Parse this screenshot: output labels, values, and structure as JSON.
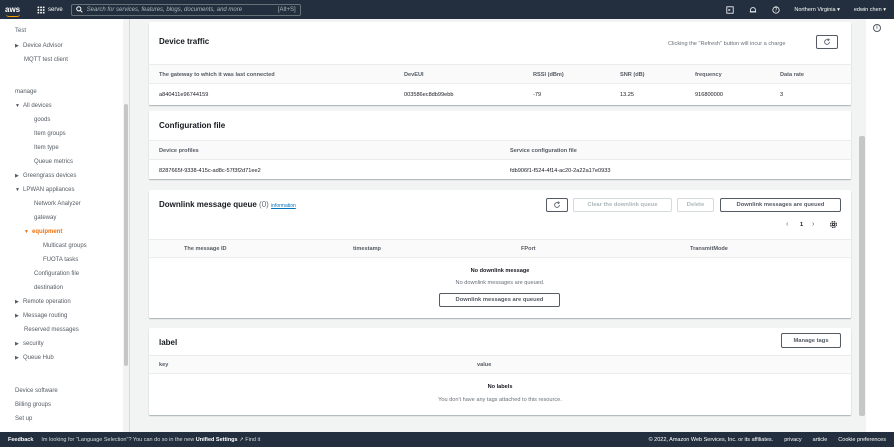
{
  "topbar": {
    "logo": "aws",
    "services_label": "serve",
    "search_placeholder": "Search for services, features, blogs, documents, and more",
    "search_shortcut": "[Alt+S]",
    "region": "Northern Virginia ▾",
    "user": "edwin chen ▾",
    "icons": [
      "grid-icon",
      "search-icon",
      "cloudshell-icon",
      "bell-icon",
      "help-icon"
    ]
  },
  "sidebar": {
    "items": [
      {
        "label": "Test",
        "type": "section"
      },
      {
        "label": "Device Advisor",
        "type": "collapsed"
      },
      {
        "label": "MQTT test client",
        "type": "item"
      },
      {
        "label": "manage",
        "type": "section"
      },
      {
        "label": "All devices",
        "type": "expanded"
      },
      {
        "label": "goods",
        "type": "sub"
      },
      {
        "label": "Item groups",
        "type": "sub"
      },
      {
        "label": "Item type",
        "type": "sub"
      },
      {
        "label": "Queue metrics",
        "type": "sub"
      },
      {
        "label": "Greengrass devices",
        "type": "collapsed"
      },
      {
        "label": "LPWAN appliances",
        "type": "expanded"
      },
      {
        "label": "Network Analyzer",
        "type": "sub"
      },
      {
        "label": "gateway",
        "type": "sub"
      },
      {
        "label": "equipment",
        "type": "active"
      },
      {
        "label": "Multicast groups",
        "type": "sub2"
      },
      {
        "label": "FUOTA tasks",
        "type": "sub2"
      },
      {
        "label": "Configuration file",
        "type": "sub"
      },
      {
        "label": "destination",
        "type": "sub"
      },
      {
        "label": "Remote operation",
        "type": "collapsed"
      },
      {
        "label": "Message routing",
        "type": "collapsed"
      },
      {
        "label": "Reserved messages",
        "type": "item"
      },
      {
        "label": "security",
        "type": "collapsed"
      },
      {
        "label": "Queue Hub",
        "type": "collapsed"
      },
      {
        "label": "Device software",
        "type": "section"
      },
      {
        "label": "Billing groups",
        "type": "section"
      },
      {
        "label": "Set up",
        "type": "section"
      }
    ]
  },
  "device_traffic": {
    "title": "Device traffic",
    "refresh_note": "Clicking the \"Refresh\" button will incur a charge",
    "refresh_icon": "refresh-icon",
    "columns": [
      "The gateway to which it was last connected",
      "DevEUI",
      "RSSI (dBm)",
      "SNR (dB)",
      "frequency",
      "Data rate"
    ],
    "row": [
      "a840411e96744159",
      "003586ec8db99ebb",
      "-79",
      "13.25",
      "916800000",
      "3"
    ]
  },
  "configuration": {
    "title": "Configuration file",
    "columns": [
      "Device profiles",
      "Service configuration file"
    ],
    "row": [
      "8287665f-9338-415c-ad8c-57f3f2d71ee2",
      "fdb906f1-f524-4f14-ac20-2a22a17e0933"
    ]
  },
  "downlink": {
    "title": "Downlink message queue",
    "count": "(0)",
    "info_link": "information",
    "btn_clear": "Clear the downlink queue",
    "btn_delete": "Delete",
    "btn_queued": "Downlink messages are queued",
    "page": "1",
    "columns": [
      "The message ID",
      "timestamp",
      "FPort",
      "TransmitMode"
    ],
    "empty_title": "No downlink message",
    "empty_text": "No downlink messages are queued.",
    "empty_button": "Downlink messages are queued"
  },
  "label": {
    "title": "label",
    "btn_manage": "Manage tags",
    "columns": [
      "key",
      "value"
    ],
    "empty_title": "No labels",
    "empty_text": "You don't have any tags attached to this resource."
  },
  "footer": {
    "feedback": "Feedback",
    "message_pre": "Im looking for \"Language Selection\"? You can do so in the new",
    "message_bold": "Unified Settings",
    "message_post": "Find it",
    "copyright": "© 2022, Amazon Web Services, Inc. or its affiliates.",
    "privacy": "privacy",
    "article": "article",
    "cookie": "Cookie preferences"
  }
}
